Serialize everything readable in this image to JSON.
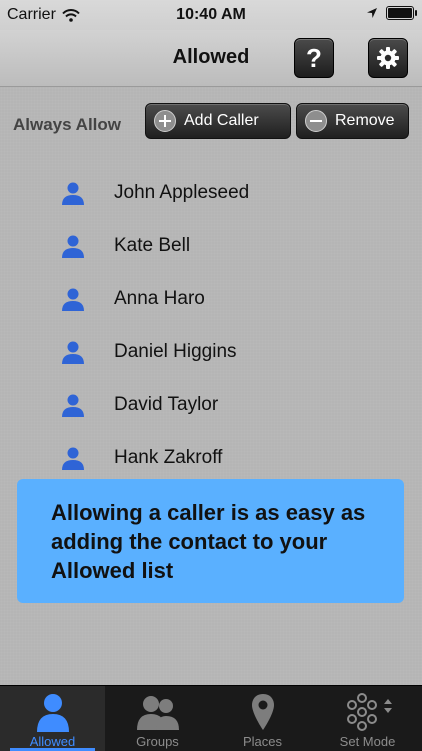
{
  "status_bar": {
    "carrier": "Carrier",
    "time": "10:40 AM"
  },
  "nav": {
    "title": "Allowed",
    "help_label": "?"
  },
  "toolbar": {
    "label": "Always Allow",
    "add_label": "Add Caller",
    "remove_label": "Remove"
  },
  "contacts": [
    {
      "name": "John Appleseed"
    },
    {
      "name": "Kate Bell"
    },
    {
      "name": "Anna Haro"
    },
    {
      "name": "Daniel Higgins"
    },
    {
      "name": "David Taylor"
    },
    {
      "name": "Hank Zakroff"
    }
  ],
  "banner": {
    "text": "Allowing a caller is as easy as adding the contact to your Allowed list"
  },
  "tabs": [
    {
      "label": "Allowed",
      "icon": "person-icon",
      "active": true
    },
    {
      "label": "Groups",
      "icon": "group-icon",
      "active": false
    },
    {
      "label": "Places",
      "icon": "map-pin-icon",
      "active": false
    },
    {
      "label": "Set Mode",
      "icon": "mode-dots-icon",
      "active": false
    }
  ],
  "colors": {
    "accent": "#3f8cff",
    "banner": "#5ab0ff",
    "contact_icon": "#2f64d6"
  }
}
